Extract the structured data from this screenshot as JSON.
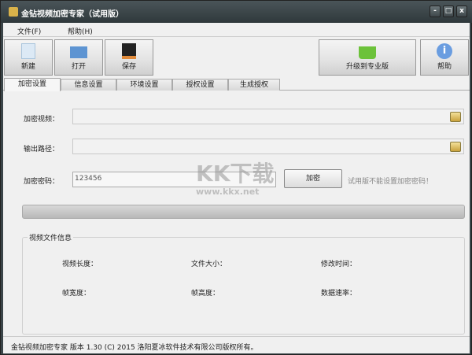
{
  "window": {
    "title": "金钻视频加密专家（试用版）",
    "controls": {
      "minimize": "-",
      "maximize": "□",
      "close": "x"
    }
  },
  "menu": [
    "文件(F)",
    "帮助(H)"
  ],
  "toolbar": {
    "new": "新建",
    "open": "打开",
    "save": "保存",
    "upgrade": "升级到专业版",
    "help": "帮助"
  },
  "tabs": [
    "加密设置",
    "信息设置",
    "环境设置",
    "授权设置",
    "生成授权"
  ],
  "form": {
    "video_label": "加密视频：",
    "video_value": "",
    "output_label": "输出路径：",
    "output_value": "",
    "password_label": "加密密码：",
    "password_value": "123456",
    "encrypt_button": "加密",
    "trial_note": "试用版不能设置加密密码！"
  },
  "progress": 0,
  "info": {
    "group_title": "视频文件信息",
    "length": "视频长度：",
    "size": "文件大小：",
    "modified": "修改时间：",
    "width": "帧宽度：",
    "height": "帧高度：",
    "rate": "数据速率："
  },
  "status": "金钻视频加密专家  版本 1.30 (C)  2015 洛阳夏冰软件技术有限公司版权所有。",
  "watermark": {
    "logo": "KK下载",
    "url": "www.kkx.net"
  }
}
